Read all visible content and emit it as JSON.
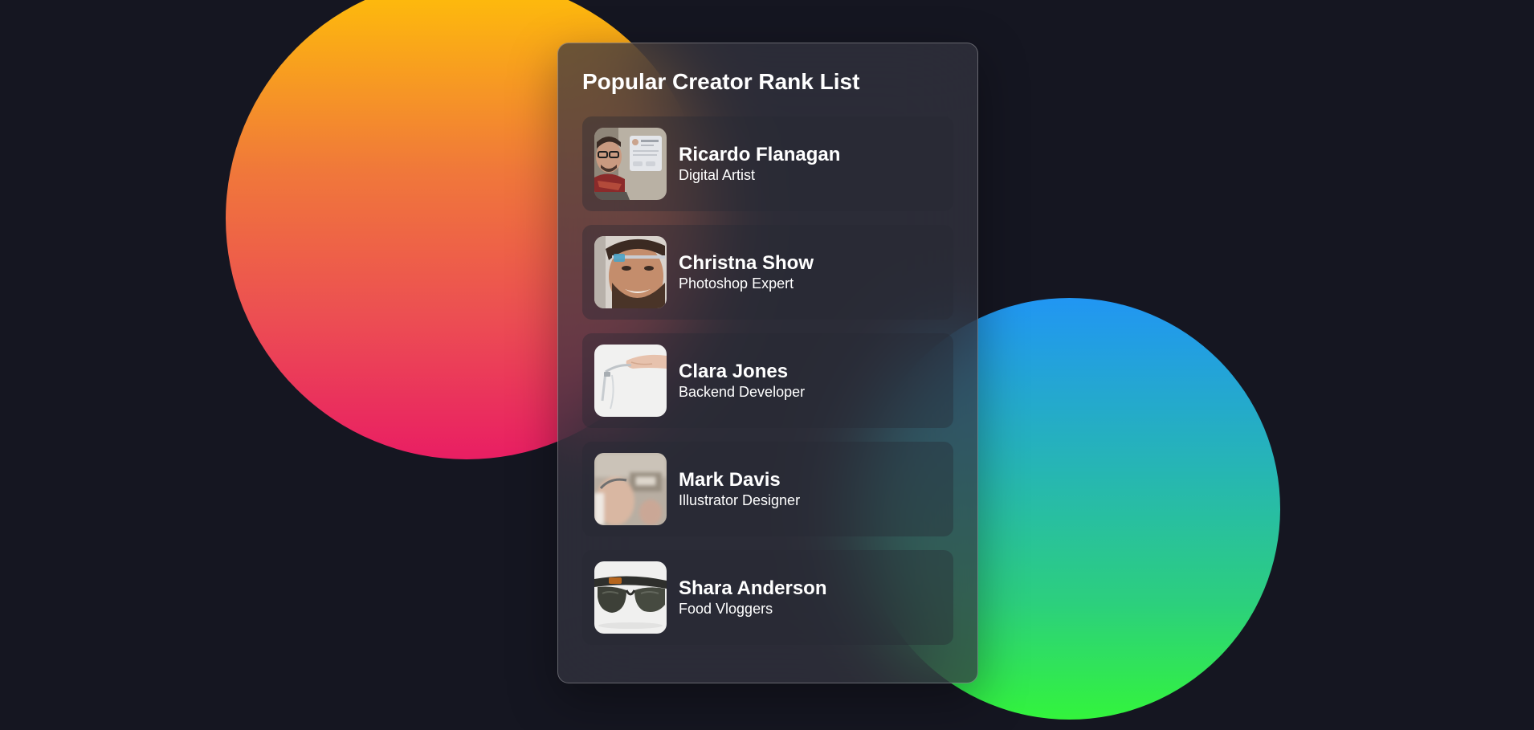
{
  "card": {
    "title": "Popular Creator Rank List"
  },
  "creators": [
    {
      "name": "Ricardo Flanagan",
      "role": "Digital Artist",
      "avatar": "man-glasses-scarf-photo"
    },
    {
      "name": "Christna Show",
      "role": "Photoshop Expert",
      "avatar": "bearded-man-smart-glasses-photo"
    },
    {
      "name": "Clara Jones",
      "role": "Backend Developer",
      "avatar": "hand-holding-glasses-photo"
    },
    {
      "name": "Mark Davis",
      "role": "Illustrator Designer",
      "avatar": "hand-with-device-photo"
    },
    {
      "name": "Shara Anderson",
      "role": "Food Vloggers",
      "avatar": "sunglasses-closeup-photo"
    }
  ],
  "colors": {
    "background": "#151621",
    "warm_gradient": [
      "#ffc107",
      "#e91e63"
    ],
    "cool_gradient": [
      "#2196f3",
      "#33f43c"
    ]
  }
}
